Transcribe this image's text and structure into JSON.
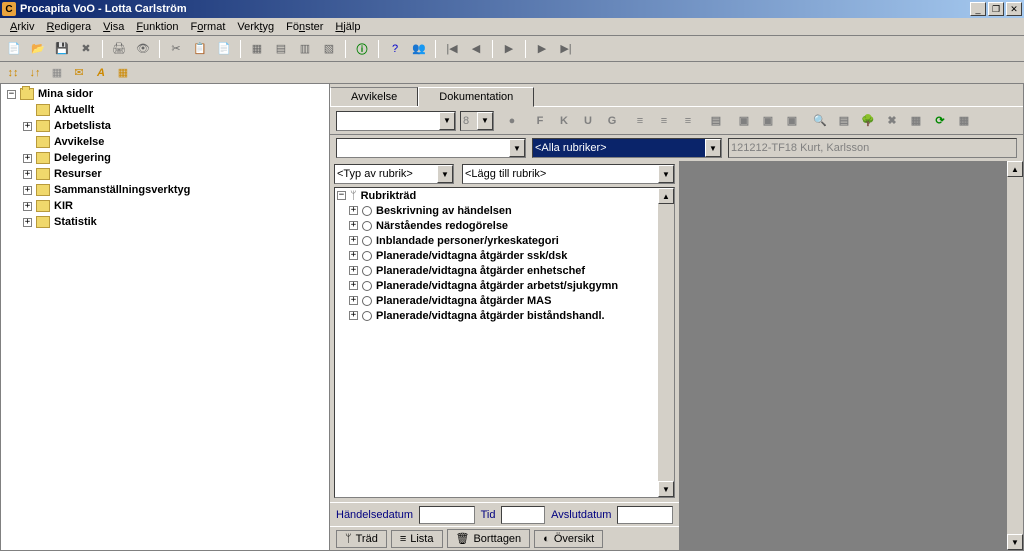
{
  "window": {
    "title": "Procapita VoO - Lotta Carlström",
    "icon_letter": "C"
  },
  "menu": [
    "Arkiv",
    "Redigera",
    "Visa",
    "Funktion",
    "Format",
    "Verktyg",
    "Fönster",
    "Hjälp"
  ],
  "sidebar": {
    "root": "Mina sidor",
    "items": [
      {
        "label": "Aktuellt",
        "toggle": ""
      },
      {
        "label": "Arbetslista",
        "toggle": "+"
      },
      {
        "label": "Avvikelse",
        "toggle": ""
      },
      {
        "label": "Delegering",
        "toggle": "+"
      },
      {
        "label": "Resurser",
        "toggle": "+"
      },
      {
        "label": "Sammanställningsverktyg",
        "toggle": "+"
      },
      {
        "label": "KIR",
        "toggle": "+"
      },
      {
        "label": "Statistik",
        "toggle": "+"
      }
    ]
  },
  "tabs": [
    {
      "label": "Avvikelse",
      "active": false
    },
    {
      "label": "Dokumentation",
      "active": true
    }
  ],
  "format": {
    "font_size": "8",
    "bold": "F",
    "italic": "K",
    "underline": "U",
    "strike": "G"
  },
  "selects": {
    "rubriker": "<Alla rubriker>",
    "person": "121212-TF18 Kurt, Karlsson",
    "typ": "<Typ av rubrik>",
    "lagg": "<Lägg till rubrik>"
  },
  "rubriktree": {
    "root": "Rubrikträd",
    "items": [
      "Beskrivning av händelsen",
      "Närståendes redogörelse",
      "Inblandade personer/yrkeskategori",
      "Planerade/vidtagna åtgärder ssk/dsk",
      "Planerade/vidtagna åtgärder enhetschef",
      "Planerade/vidtagna åtgärder arbetst/sjukgymn",
      "Planerade/vidtagna åtgärder MAS",
      "Planerade/vidtagna åtgärder biståndshandl."
    ]
  },
  "dates": {
    "handelsedatum": "Händelsedatum",
    "tid": "Tid",
    "avslutdatum": "Avslutdatum"
  },
  "bottomtabs": [
    "Träd",
    "Lista",
    "Borttagen",
    "Översikt"
  ]
}
